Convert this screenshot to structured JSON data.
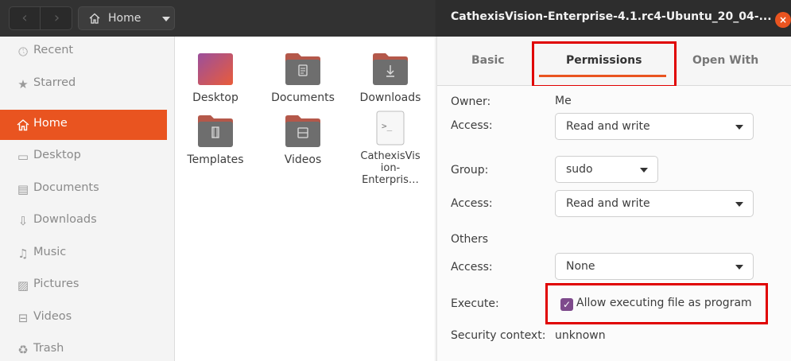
{
  "file_manager": {
    "path_label": "Home",
    "sidebar": [
      {
        "label": "Recent",
        "icon": "clock-icon"
      },
      {
        "label": "Starred",
        "icon": "star-icon"
      },
      {
        "label": "Home",
        "icon": "home-icon",
        "active": true
      },
      {
        "label": "Desktop",
        "icon": "desktop-icon"
      },
      {
        "label": "Documents",
        "icon": "document-icon"
      },
      {
        "label": "Downloads",
        "icon": "download-icon"
      },
      {
        "label": "Music",
        "icon": "music-icon"
      },
      {
        "label": "Pictures",
        "icon": "picture-icon"
      },
      {
        "label": "Videos",
        "icon": "video-icon"
      },
      {
        "label": "Trash",
        "icon": "trash-icon"
      }
    ],
    "files": [
      {
        "name": "Desktop",
        "icon": "desktop-folder-icon"
      },
      {
        "name": "Documents",
        "icon": "documents-folder-icon"
      },
      {
        "name": "Downloads",
        "icon": "downloads-folder-icon"
      },
      {
        "name": "Templates",
        "icon": "templates-folder-icon"
      },
      {
        "name": "Videos",
        "icon": "videos-folder-icon"
      },
      {
        "name_lines": [
          "CathexisVis",
          "ion-",
          "Enterpris…"
        ],
        "icon": "script-file-icon"
      }
    ]
  },
  "dialog": {
    "title": "CathexisVision-Enterprise-4.1.rc4-Ubuntu_20_04-...",
    "close_glyph": "×",
    "tabs": {
      "basic": "Basic",
      "permissions": "Permissions",
      "open_with": "Open With"
    },
    "owner_label": "Owner:",
    "owner_value": "Me",
    "owner_access_label": "Access:",
    "owner_access_value": "Read and write",
    "group_label": "Group:",
    "group_value": "sudo",
    "group_access_label": "Access:",
    "group_access_value": "Read and write",
    "others_label": "Others",
    "others_access_label": "Access:",
    "others_access_value": "None",
    "execute_label": "Execute:",
    "execute_checkbox_label": "Allow executing file as program",
    "execute_checked": true,
    "security_label": "Security context:",
    "security_value": "unknown"
  },
  "colors": {
    "accent": "#e95420",
    "checkbox": "#7e4a8c",
    "highlight": "#e00000"
  }
}
